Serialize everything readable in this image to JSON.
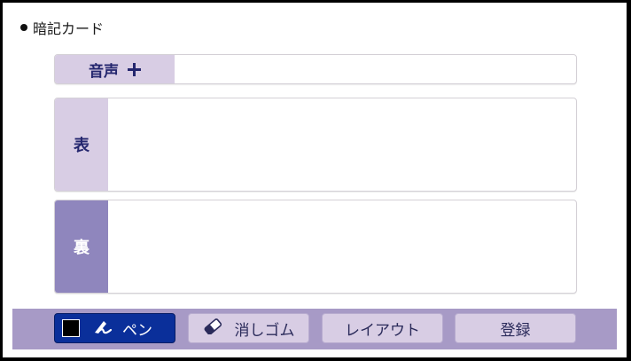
{
  "header": {
    "title": "暗記カード"
  },
  "audio": {
    "label": "音声",
    "add_icon": "plus-icon"
  },
  "card": {
    "front_label": "表",
    "back_label": "裏",
    "front_text": "",
    "back_text": ""
  },
  "toolbar": {
    "pen_label": "ペン",
    "pen_color": "#000000",
    "pen_icon": "pen-icon",
    "eraser_label": "消しゴム",
    "eraser_icon": "eraser-icon",
    "layout_label": "レイアウト",
    "register_label": "登録"
  },
  "colors": {
    "accent_light": "#d8cde4",
    "accent_dark": "#8f86bd",
    "toolbar_bg": "#a79ac6",
    "pen_active": "#0a2f9a"
  }
}
